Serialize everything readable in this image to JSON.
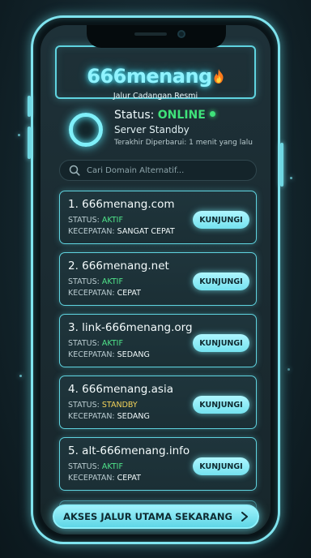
{
  "header": {
    "brand": "666menang",
    "subtitle": "Jalur Cadangan Resmi"
  },
  "status": {
    "label": "Status:",
    "value": "ONLINE",
    "server": "Server Standby",
    "updated": "Terakhir Diperbarui: 1 menit yang lalu"
  },
  "search": {
    "placeholder": "Cari Domain Alternatif..."
  },
  "domains": [
    {
      "title": "1. 666menang.com",
      "status_label": "STATUS:",
      "status": "AKTIF",
      "speed_label": "KECEPATAN:",
      "speed": "SANGAT CEPAT",
      "button": "KUNJUNGI"
    },
    {
      "title": "2. 666menang.net",
      "status_label": "STATUS:",
      "status": "AKTIF",
      "speed_label": "KECEPATAN:",
      "speed": "CEPAT",
      "button": "KUNJUNGI"
    },
    {
      "title": "3. link-666menang.org",
      "status_label": "STATUS:",
      "status": "AKTIF",
      "speed_label": "KECEPATAN:",
      "speed": "SEDANG",
      "button": "KUNJUNGI"
    },
    {
      "title": "4. 666menang.asia",
      "status_label": "STATUS:",
      "status": "STANDBY",
      "speed_label": "KECEPATAN:",
      "speed": "SEDANG",
      "button": "KUNJUNGI"
    },
    {
      "title": "5. alt-666menang.info",
      "status_label": "STATUS:",
      "status": "AKTIF",
      "speed_label": "KECEPATAN:",
      "speed": "CEPAT",
      "button": "KUNJUNGI"
    }
  ],
  "cta": {
    "label": "AKSES JALUR UTAMA SEKARANG"
  },
  "colors": {
    "accent": "#7fe3ee",
    "online": "#3fe27a",
    "active": "#4fe38a",
    "standby": "#f2d25a"
  },
  "icons": {
    "brand_emoji": "flame-icon",
    "search": "search-icon",
    "cta": "chevron-right-icon"
  }
}
